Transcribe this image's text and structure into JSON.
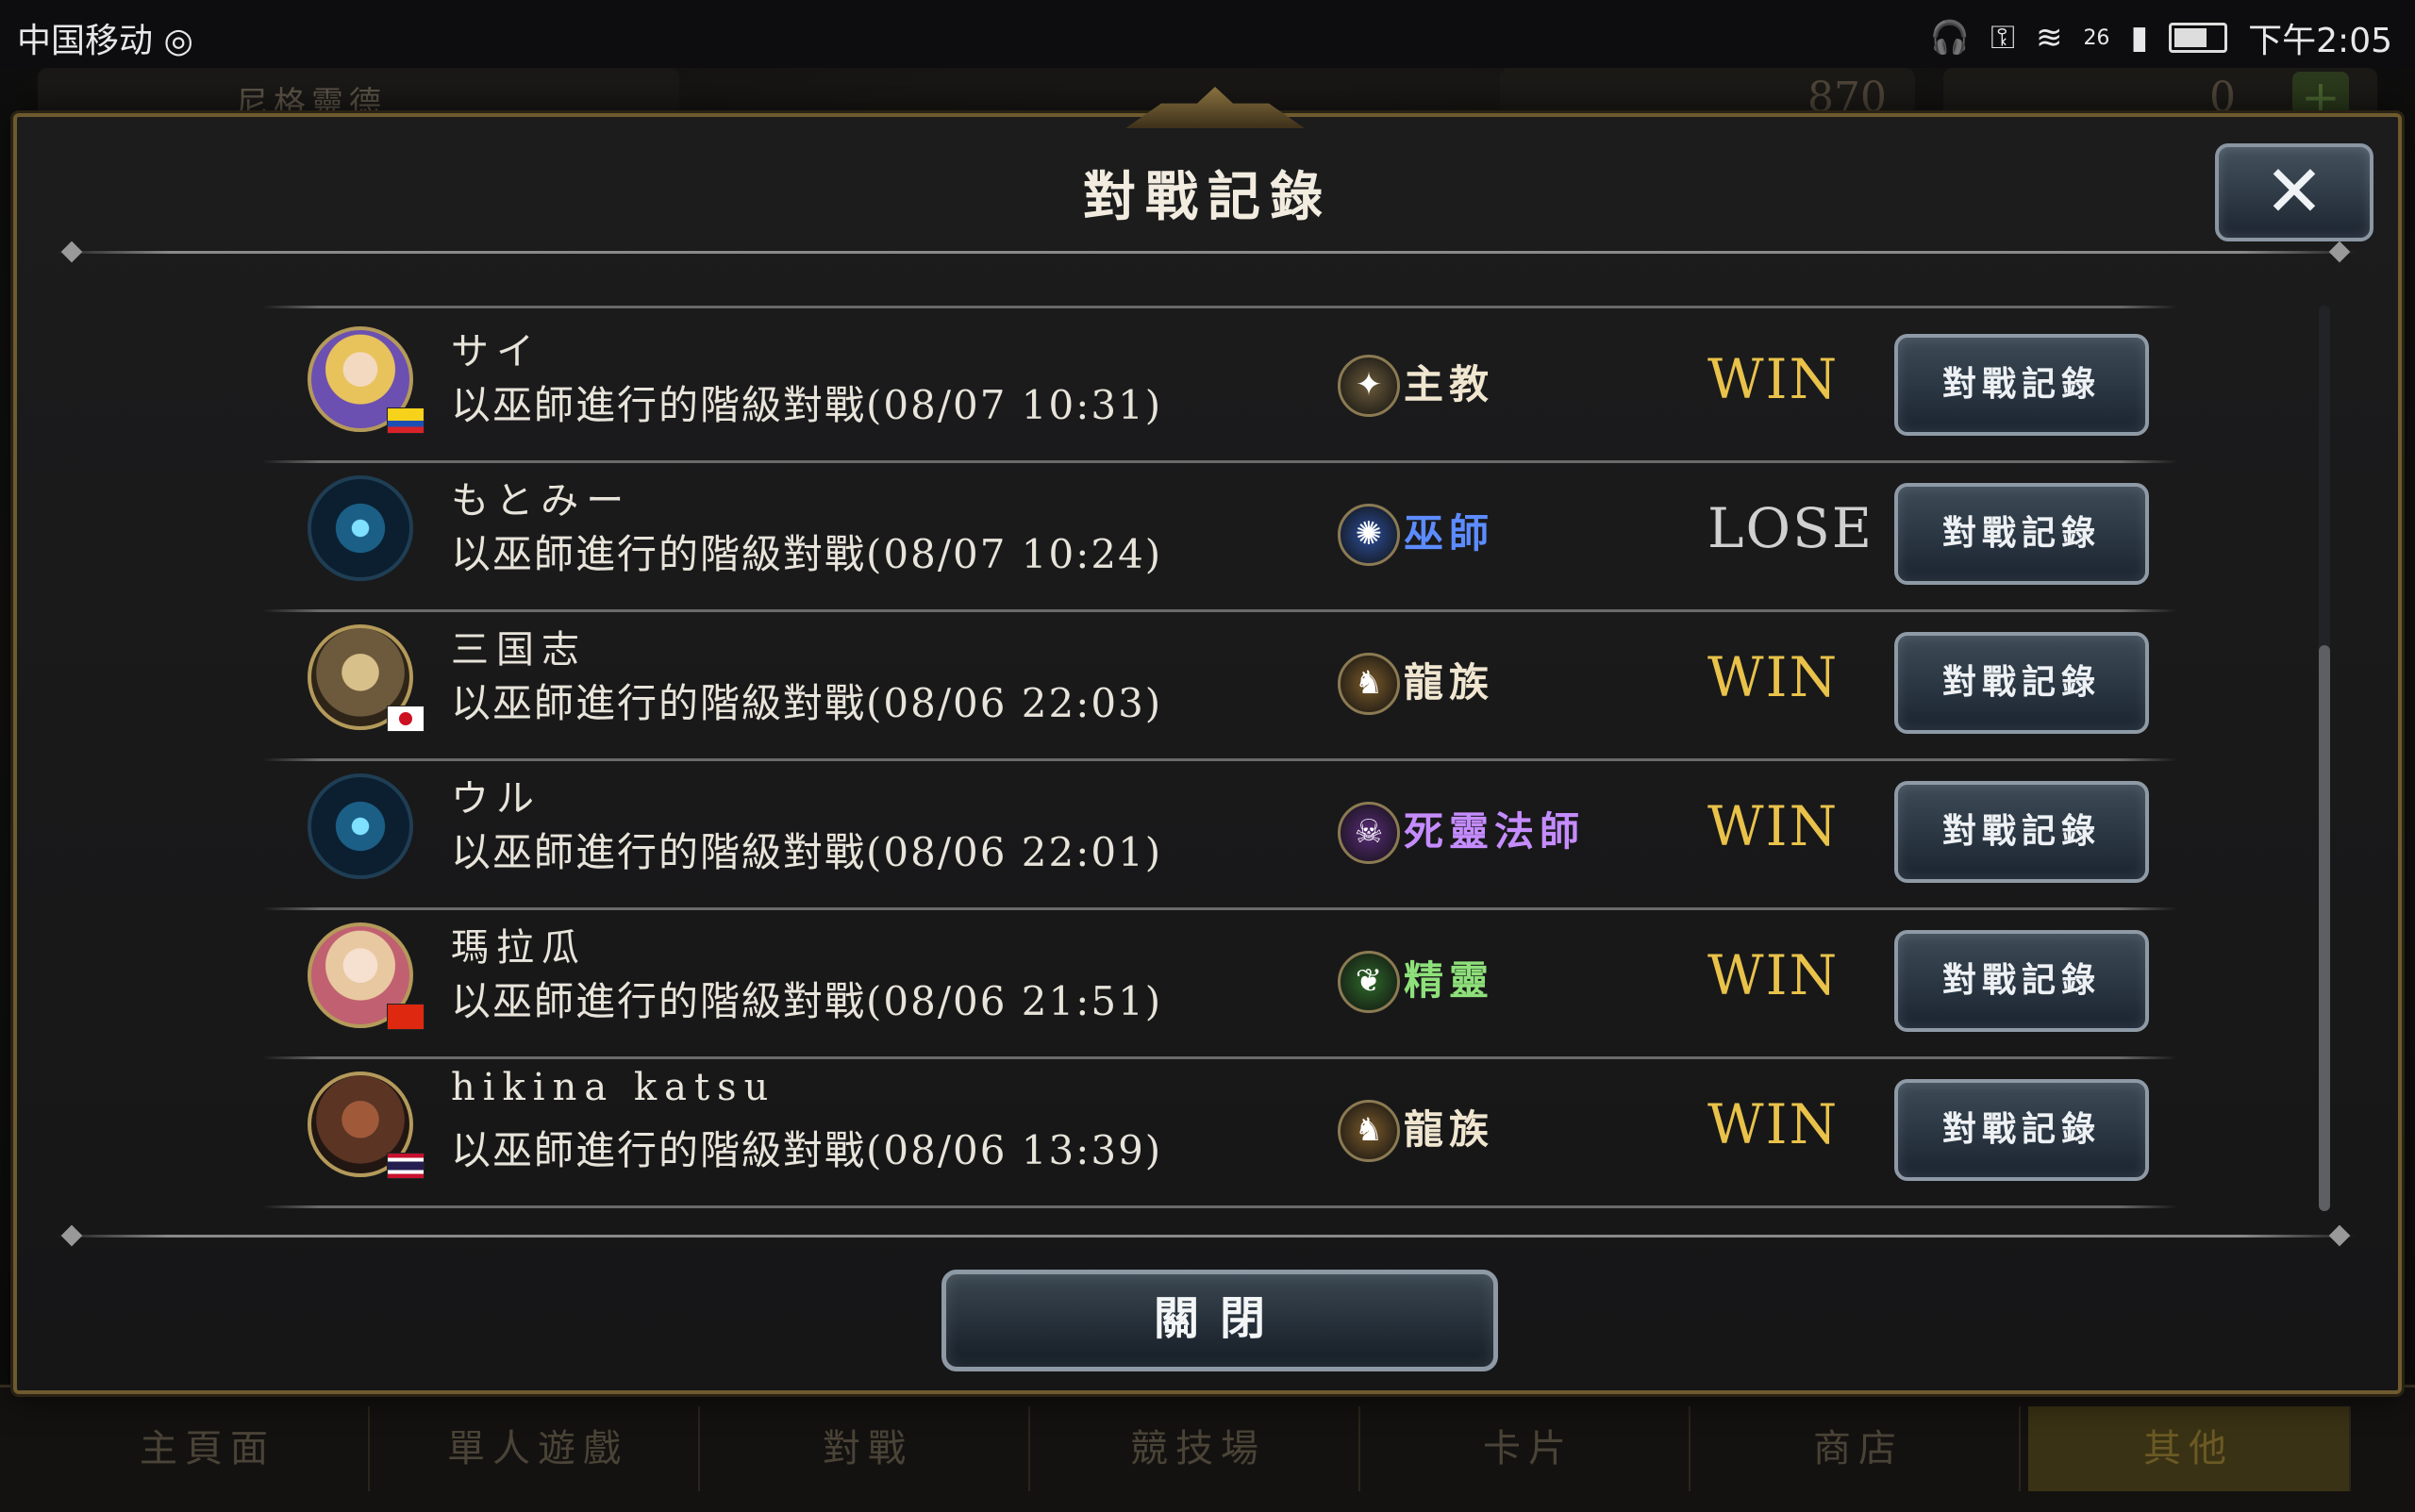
{
  "statusbar": {
    "carrier": "中国移动 ◎",
    "network": "26",
    "time": "下午2:05"
  },
  "background": {
    "player_name": "尼格靈德",
    "resource_1": "870",
    "resource_2": "0",
    "plus": "+",
    "bottom_nav": [
      "主頁面",
      "單人遊戲",
      "對戰",
      "競技場",
      "卡片",
      "商店",
      "其他"
    ]
  },
  "modal": {
    "title": "對戰記錄",
    "close_icon": "✕",
    "close_button": "關閉",
    "record_button_label": "對戰記錄",
    "colors": {
      "win": "#e9c24a",
      "lose": "#d0d0d0",
      "bishop": "#f0e6d0",
      "witch": "#5c8cff",
      "dragon": "#f0e6d0",
      "necro": "#c58cff",
      "elf": "#8ee07a"
    },
    "rows": [
      {
        "name": "サイ",
        "desc": "以巫師進行的階級對戰(08/07 10:31)",
        "class": "主教",
        "class_icon": "bishop-icon",
        "class_glyph": "✦",
        "result": "WIN",
        "avatar": "anime-blonde",
        "flag": "co"
      },
      {
        "name": "もとみー",
        "desc": "以巫師進行的階級對戰(08/07 10:24)",
        "class": "巫師",
        "class_icon": "witch-icon",
        "class_glyph": "✺",
        "result": "LOSE",
        "avatar": "blue-emblem",
        "flag": ""
      },
      {
        "name": "三国志",
        "desc": "以巫師進行的階級對戰(08/06 22:03)",
        "class": "龍族",
        "class_icon": "dragon-icon",
        "class_glyph": "♞",
        "result": "WIN",
        "avatar": "gold-knight",
        "flag": "jp"
      },
      {
        "name": "ウル",
        "desc": "以巫師進行的階級對戰(08/06 22:01)",
        "class": "死靈法師",
        "class_icon": "necromancer-icon",
        "class_glyph": "☠",
        "result": "WIN",
        "avatar": "blue-emblem",
        "flag": ""
      },
      {
        "name": "瑪拉瓜",
        "desc": "以巫師進行的階級對戰(08/06 21:51)",
        "class": "精靈",
        "class_icon": "elf-icon",
        "class_glyph": "❦",
        "result": "WIN",
        "avatar": "anime-pink",
        "flag": "cn"
      },
      {
        "name": "hikina katsu",
        "desc": "以巫師進行的階級對戰(08/06 13:39)",
        "class": "龍族",
        "class_icon": "dragon-icon",
        "class_glyph": "♞",
        "result": "WIN",
        "avatar": "beast",
        "flag": "th"
      }
    ]
  }
}
